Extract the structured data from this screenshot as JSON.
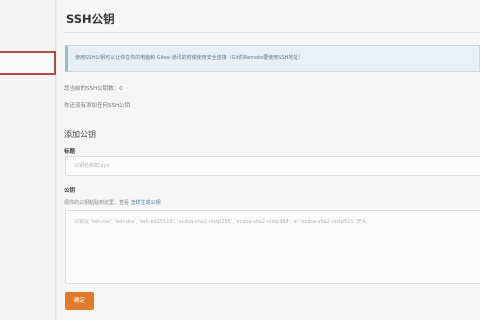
{
  "page": {
    "title": "SSH公钥"
  },
  "notice": {
    "text": "使用SSH公钥可以让你在你的电脑和 Gitee 通讯的时候使用安全连接（Git的Remote要使用SSH地址）"
  },
  "status": {
    "count_text": "您当前的SSH公钥数：0",
    "empty_text": "你还没有添加任何SSH公钥"
  },
  "form": {
    "section_title": "添加公钥",
    "title_label": "标题",
    "title_placeholder": "公钥名称如:xyz",
    "key_label": "公钥",
    "key_help": "把你的公钥粘贴到这里，查看",
    "key_help_link": "怎样生成公钥",
    "key_placeholder": "公钥以 'ssh-rsa', 'ssh-dss', 'ssh-ed25519', 'ecdsa-sha2-nistp256', 'ecdsa-sha2-nistp384', or 'ecdsa-sha2-nistp521' 开头",
    "submit_label": "确定"
  },
  "colors": {
    "accent": "#e07b2e",
    "notice_bg": "#e9f0f4",
    "active_outline": "#b44a44",
    "link": "#4a7fa8"
  }
}
